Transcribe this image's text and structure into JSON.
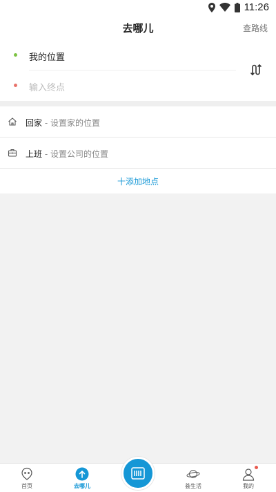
{
  "status_bar": {
    "time": "11:26"
  },
  "header": {
    "title": "去哪儿",
    "right_action": "查路线"
  },
  "route": {
    "start_label": "我的位置",
    "end_placeholder": "输入终点",
    "start_dot_color": "#7cc242",
    "end_dot_color": "#e8736b"
  },
  "places": [
    {
      "name": "回家",
      "hint": "设置家的位置",
      "icon": "home-icon"
    },
    {
      "name": "上班",
      "hint": "设置公司的位置",
      "icon": "briefcase-icon"
    }
  ],
  "add_place_label": "十添加地点",
  "tabbar": {
    "tabs": [
      {
        "label": "首页",
        "icon": "home-face-icon"
      },
      {
        "label": "去哪儿",
        "icon": "go-arrow-icon",
        "active": true
      },
      {
        "label": "荟生活",
        "icon": "planet-icon"
      },
      {
        "label": "我的",
        "icon": "user-icon",
        "badge": true
      }
    ],
    "center_icon": "scan-icon"
  },
  "colors": {
    "accent": "#1597d6",
    "badge": "#e85a4f"
  }
}
